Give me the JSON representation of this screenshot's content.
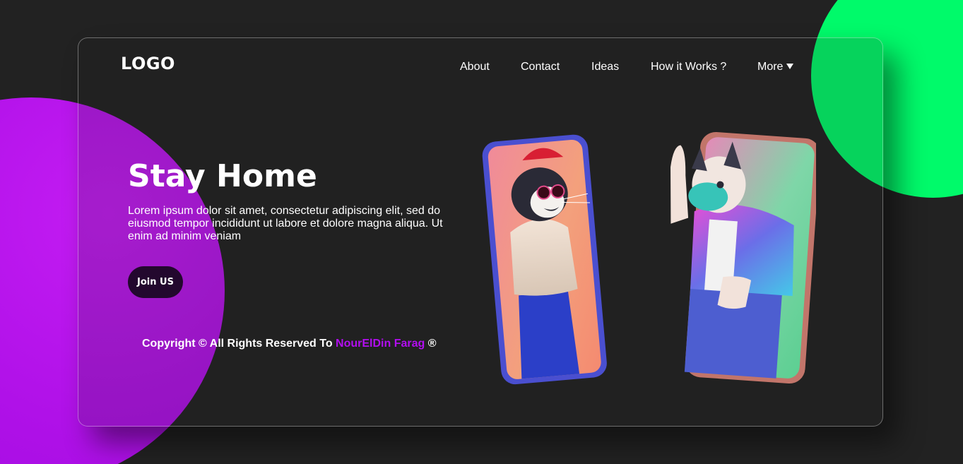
{
  "header": {
    "logo": "LOGO",
    "nav": [
      {
        "label": "About"
      },
      {
        "label": "Contact"
      },
      {
        "label": "Ideas"
      },
      {
        "label": "How it Works ?"
      },
      {
        "label": "More",
        "icon": "caret-down-icon"
      }
    ]
  },
  "hero": {
    "title": "Stay Home",
    "text": "Lorem ipsum dolor sit amet, consectetur adipiscing elit, sed do eiusmod tempor incididunt ut labore et dolore magna aliqua. Ut enim ad minim veniam",
    "button_label": "Join US"
  },
  "footer": {
    "copyright_prefix": "Copyright © All Rights Reserved To",
    "author": "NourElDin Farag",
    "suffix": "®"
  },
  "colors": {
    "background": "#222222",
    "purple_blob": "#b011e8",
    "green_blob": "#00fa6a",
    "author_accent": "#b20ef0",
    "button_bg": "#23082e"
  }
}
